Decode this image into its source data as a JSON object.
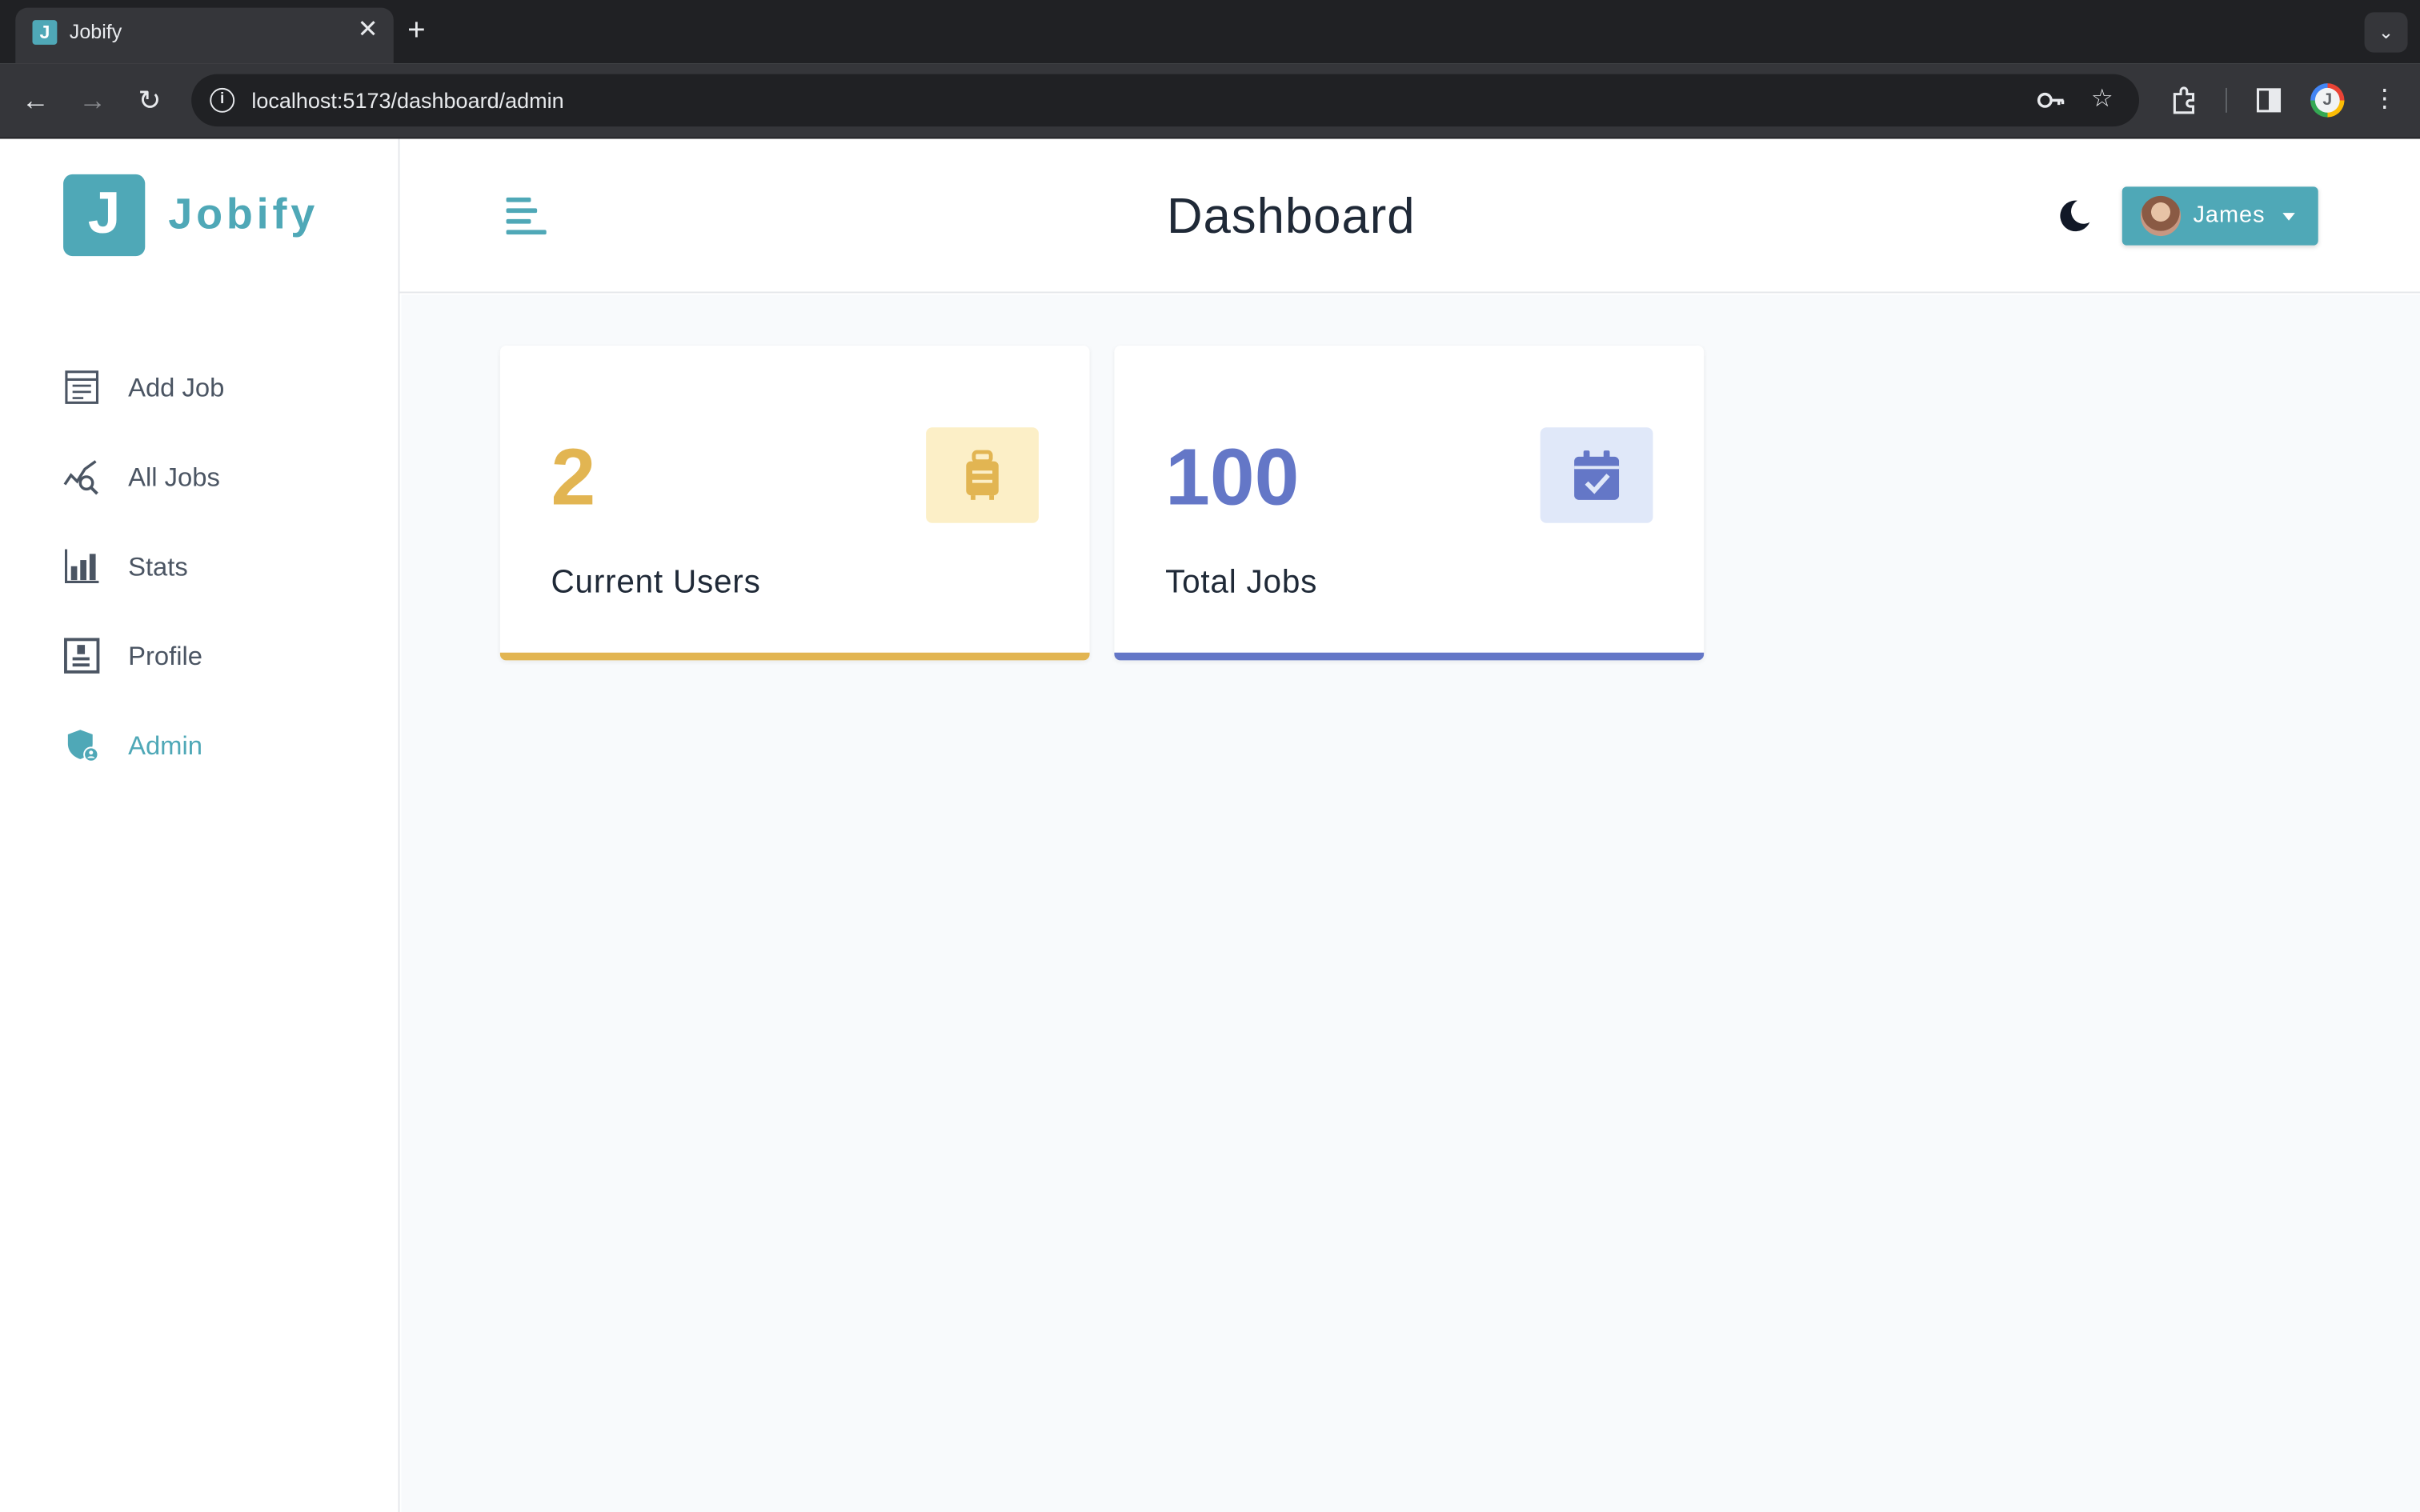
{
  "browser": {
    "tab_title": "Jobify",
    "tab_favicon_letter": "J",
    "url": "localhost:5173/dashboard/admin",
    "new_tab": "+",
    "tab_close": "✕"
  },
  "app": {
    "logo_letter": "J",
    "logo_text": "Jobify",
    "brand_color": "#4fa8b7"
  },
  "sidebar": {
    "items": [
      {
        "label": "Add Job",
        "icon": "add-job-icon",
        "active": false
      },
      {
        "label": "All Jobs",
        "icon": "all-jobs-icon",
        "active": false
      },
      {
        "label": "Stats",
        "icon": "stats-icon",
        "active": false
      },
      {
        "label": "Profile",
        "icon": "profile-icon",
        "active": false
      },
      {
        "label": "Admin",
        "icon": "admin-icon",
        "active": true
      }
    ]
  },
  "header": {
    "title": "Dashboard",
    "user_name": "James"
  },
  "stats": [
    {
      "count": "2",
      "title": "Current Users",
      "color": "#e2b552",
      "bg": "#fcefc7",
      "icon": "suitcase-icon"
    },
    {
      "count": "100",
      "title": "Total Jobs",
      "color": "#6477c7",
      "bg": "#e0e8f9",
      "icon": "calendar-check-icon"
    }
  ]
}
